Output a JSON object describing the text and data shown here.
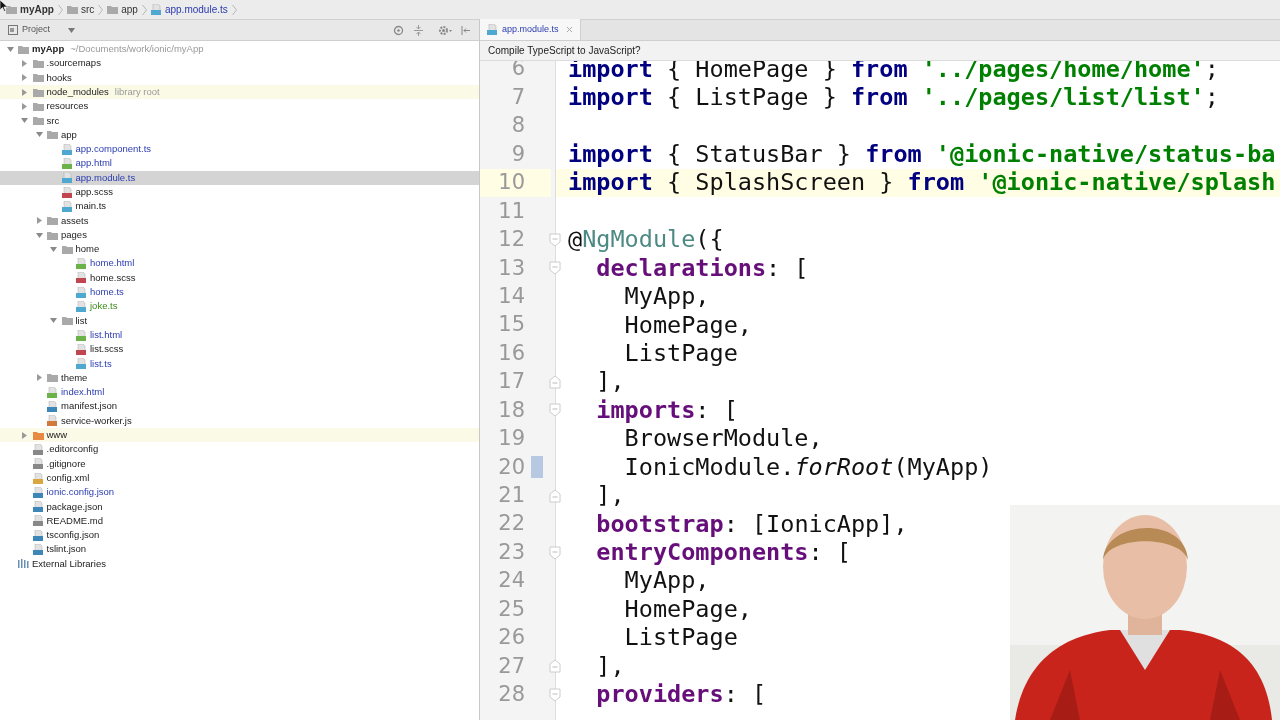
{
  "breadcrumbs": [
    {
      "label": "myApp",
      "kind": "folder"
    },
    {
      "label": "src",
      "kind": "folder"
    },
    {
      "label": "app",
      "kind": "folder"
    },
    {
      "label": "app.module.ts",
      "kind": "ts"
    }
  ],
  "project_panel": {
    "title": "Project",
    "tree": [
      {
        "name": "myApp",
        "note": "~/Documents/work/ionic/myApp",
        "kind": "folder",
        "expanded": true,
        "selected": false,
        "highlighted": false,
        "modified": false,
        "added": false,
        "children": [
          {
            "name": ".sourcemaps",
            "kind": "folder",
            "expanded": false,
            "selected": false,
            "highlighted": false,
            "modified": false,
            "added": false
          },
          {
            "name": "hooks",
            "kind": "folder",
            "expanded": false,
            "selected": false,
            "highlighted": false,
            "modified": false,
            "added": false
          },
          {
            "name": "node_modules",
            "note": "library root",
            "kind": "folder",
            "expanded": false,
            "selected": false,
            "highlighted": true,
            "modified": false,
            "added": false
          },
          {
            "name": "resources",
            "kind": "folder",
            "expanded": false,
            "selected": false,
            "highlighted": false,
            "modified": false,
            "added": false
          },
          {
            "name": "src",
            "kind": "folder",
            "expanded": true,
            "selected": false,
            "highlighted": false,
            "modified": false,
            "added": false,
            "children": [
              {
                "name": "app",
                "kind": "folder",
                "expanded": true,
                "selected": false,
                "highlighted": false,
                "modified": false,
                "added": false,
                "children": [
                  {
                    "name": "app.component.ts",
                    "kind": "ts",
                    "selected": false,
                    "highlighted": false,
                    "modified": true,
                    "added": false
                  },
                  {
                    "name": "app.html",
                    "kind": "html",
                    "selected": false,
                    "highlighted": false,
                    "modified": true,
                    "added": false
                  },
                  {
                    "name": "app.module.ts",
                    "kind": "ts",
                    "selected": true,
                    "highlighted": false,
                    "modified": true,
                    "added": false
                  },
                  {
                    "name": "app.scss",
                    "kind": "scss",
                    "selected": false,
                    "highlighted": false,
                    "modified": false,
                    "added": false
                  },
                  {
                    "name": "main.ts",
                    "kind": "ts",
                    "selected": false,
                    "highlighted": false,
                    "modified": false,
                    "added": false
                  }
                ]
              },
              {
                "name": "assets",
                "kind": "folder",
                "expanded": false,
                "selected": false,
                "highlighted": false,
                "modified": false,
                "added": false
              },
              {
                "name": "pages",
                "kind": "folder",
                "expanded": true,
                "selected": false,
                "highlighted": false,
                "modified": false,
                "added": false,
                "children": [
                  {
                    "name": "home",
                    "kind": "folder",
                    "expanded": true,
                    "selected": false,
                    "highlighted": false,
                    "modified": false,
                    "added": false,
                    "children": [
                      {
                        "name": "home.html",
                        "kind": "html",
                        "selected": false,
                        "highlighted": false,
                        "modified": true,
                        "added": false
                      },
                      {
                        "name": "home.scss",
                        "kind": "scss",
                        "selected": false,
                        "highlighted": false,
                        "modified": false,
                        "added": false
                      },
                      {
                        "name": "home.ts",
                        "kind": "ts",
                        "selected": false,
                        "highlighted": false,
                        "modified": true,
                        "added": false
                      },
                      {
                        "name": "joke.ts",
                        "kind": "ts",
                        "selected": false,
                        "highlighted": false,
                        "modified": false,
                        "added": true
                      }
                    ]
                  },
                  {
                    "name": "list",
                    "kind": "folder",
                    "expanded": true,
                    "selected": false,
                    "highlighted": false,
                    "modified": false,
                    "added": false,
                    "children": [
                      {
                        "name": "list.html",
                        "kind": "html",
                        "selected": false,
                        "highlighted": false,
                        "modified": true,
                        "added": false
                      },
                      {
                        "name": "list.scss",
                        "kind": "scss",
                        "selected": false,
                        "highlighted": false,
                        "modified": false,
                        "added": false
                      },
                      {
                        "name": "list.ts",
                        "kind": "ts",
                        "selected": false,
                        "highlighted": false,
                        "modified": true,
                        "added": false
                      }
                    ]
                  }
                ]
              },
              {
                "name": "theme",
                "kind": "folder",
                "expanded": false,
                "selected": false,
                "highlighted": false,
                "modified": false,
                "added": false
              },
              {
                "name": "index.html",
                "kind": "html",
                "selected": false,
                "highlighted": false,
                "modified": true,
                "added": false
              },
              {
                "name": "manifest.json",
                "kind": "json",
                "selected": false,
                "highlighted": false,
                "modified": false,
                "added": false
              },
              {
                "name": "service-worker.js",
                "kind": "js",
                "selected": false,
                "highlighted": false,
                "modified": false,
                "added": false
              }
            ]
          },
          {
            "name": "www",
            "kind": "excluded",
            "expanded": false,
            "selected": false,
            "highlighted": true,
            "modified": false,
            "added": false
          },
          {
            "name": ".editorconfig",
            "kind": "text",
            "selected": false,
            "highlighted": false,
            "modified": false,
            "added": false
          },
          {
            "name": ".gitignore",
            "kind": "text",
            "selected": false,
            "highlighted": false,
            "modified": false,
            "added": false
          },
          {
            "name": "config.xml",
            "kind": "xml",
            "selected": false,
            "highlighted": false,
            "modified": false,
            "added": false
          },
          {
            "name": "ionic.config.json",
            "kind": "json",
            "selected": false,
            "highlighted": false,
            "modified": true,
            "added": false
          },
          {
            "name": "package.json",
            "kind": "json",
            "selected": false,
            "highlighted": false,
            "modified": false,
            "added": false
          },
          {
            "name": "README.md",
            "kind": "text",
            "selected": false,
            "highlighted": false,
            "modified": false,
            "added": false
          },
          {
            "name": "tsconfig.json",
            "kind": "json",
            "selected": false,
            "highlighted": false,
            "modified": false,
            "added": false
          },
          {
            "name": "tslint.json",
            "kind": "json",
            "selected": false,
            "highlighted": false,
            "modified": false,
            "added": false
          }
        ]
      },
      {
        "name": "External Libraries",
        "kind": "libraries",
        "selected": false,
        "highlighted": false,
        "modified": false,
        "added": false
      }
    ]
  },
  "editor": {
    "tabs": [
      {
        "label": "app.module.ts",
        "kind": "ts",
        "selected": true
      }
    ],
    "notification": "Compile TypeScript to JavaScript?",
    "lines": [
      {
        "number": "6",
        "kind": "plain",
        "current": false,
        "changed": false,
        "tokens": [
          {
            "kind": "keyword",
            "text": "import"
          },
          {
            "kind": "plain",
            "text": " { HomePage } "
          },
          {
            "kind": "keyword",
            "text": "from"
          },
          {
            "kind": "string",
            "text": " '../pages/home/home'"
          },
          {
            "kind": "plain",
            "text": ";"
          }
        ]
      },
      {
        "number": "7",
        "kind": "plain",
        "current": false,
        "changed": false,
        "tokens": [
          {
            "kind": "keyword",
            "text": "import"
          },
          {
            "kind": "plain",
            "text": " { ListPage } "
          },
          {
            "kind": "keyword",
            "text": "from"
          },
          {
            "kind": "string",
            "text": " '../pages/list/list'"
          },
          {
            "kind": "plain",
            "text": ";"
          }
        ]
      },
      {
        "number": "8",
        "kind": "plain",
        "current": false,
        "changed": false
      },
      {
        "number": "9",
        "kind": "plain",
        "current": false,
        "changed": false,
        "tokens": [
          {
            "kind": "keyword",
            "text": "import"
          },
          {
            "kind": "plain",
            "text": " { StatusBar } "
          },
          {
            "kind": "keyword",
            "text": "from"
          },
          {
            "kind": "string",
            "text": " '@ionic-native/status-ba"
          }
        ]
      },
      {
        "number": "10",
        "kind": "plain",
        "current": true,
        "changed": false,
        "tokens": [
          {
            "kind": "keyword",
            "text": "import"
          },
          {
            "kind": "plain",
            "text": " { SplashScreen } "
          },
          {
            "kind": "keyword",
            "text": "from"
          },
          {
            "kind": "string",
            "text": " '@ionic-native/splash"
          }
        ]
      },
      {
        "number": "11",
        "kind": "plain",
        "current": false,
        "changed": false
      },
      {
        "number": "12",
        "kind": "fold-start",
        "current": false,
        "changed": false,
        "tokens": [
          {
            "kind": "plain",
            "text": "@"
          },
          {
            "kind": "decorator",
            "text": "NgModule"
          },
          {
            "kind": "plain",
            "text": "({"
          }
        ]
      },
      {
        "number": "13",
        "kind": "fold-start",
        "current": false,
        "changed": false,
        "tokens": [
          {
            "kind": "key",
            "text": "  declarations"
          },
          {
            "kind": "plain",
            "text": ": ["
          }
        ]
      },
      {
        "number": "14",
        "kind": "plain",
        "current": false,
        "changed": false,
        "tokens": [
          {
            "kind": "plain",
            "text": "    MyApp,"
          }
        ]
      },
      {
        "number": "15",
        "kind": "plain",
        "current": false,
        "changed": false,
        "tokens": [
          {
            "kind": "plain",
            "text": "    HomePage,"
          }
        ]
      },
      {
        "number": "16",
        "kind": "plain",
        "current": false,
        "changed": false,
        "tokens": [
          {
            "kind": "plain",
            "text": "    ListPage"
          }
        ]
      },
      {
        "number": "17",
        "kind": "fold-end",
        "current": false,
        "changed": false,
        "tokens": [
          {
            "kind": "plain",
            "text": "  ],"
          }
        ]
      },
      {
        "number": "18",
        "kind": "fold-start",
        "current": false,
        "changed": false,
        "tokens": [
          {
            "kind": "key",
            "text": "  imports"
          },
          {
            "kind": "plain",
            "text": ": ["
          }
        ]
      },
      {
        "number": "19",
        "kind": "plain",
        "current": false,
        "changed": false,
        "tokens": [
          {
            "kind": "plain",
            "text": "    BrowserModule,"
          }
        ]
      },
      {
        "number": "20",
        "kind": "plain",
        "current": false,
        "changed": true,
        "tokens": [
          {
            "kind": "plain",
            "text": "    IonicModule."
          },
          {
            "kind": "call",
            "text": "forRoot"
          },
          {
            "kind": "plain",
            "text": "(MyApp)"
          }
        ]
      },
      {
        "number": "21",
        "kind": "fold-end",
        "current": false,
        "changed": false,
        "tokens": [
          {
            "kind": "plain",
            "text": "  ],"
          }
        ]
      },
      {
        "number": "22",
        "kind": "plain",
        "current": false,
        "changed": false,
        "tokens": [
          {
            "kind": "key",
            "text": "  bootstrap"
          },
          {
            "kind": "plain",
            "text": ": [IonicApp],"
          }
        ]
      },
      {
        "number": "23",
        "kind": "fold-start",
        "current": false,
        "changed": false,
        "tokens": [
          {
            "kind": "key",
            "text": "  entryComponents"
          },
          {
            "kind": "plain",
            "text": ": ["
          }
        ]
      },
      {
        "number": "24",
        "kind": "plain",
        "current": false,
        "changed": false,
        "tokens": [
          {
            "kind": "plain",
            "text": "    MyApp,"
          }
        ]
      },
      {
        "number": "25",
        "kind": "plain",
        "current": false,
        "changed": false,
        "tokens": [
          {
            "kind": "plain",
            "text": "    HomePage,"
          }
        ]
      },
      {
        "number": "26",
        "kind": "plain",
        "current": false,
        "changed": false,
        "tokens": [
          {
            "kind": "plain",
            "text": "    ListPage"
          }
        ]
      },
      {
        "number": "27",
        "kind": "fold-end",
        "current": false,
        "changed": false,
        "tokens": [
          {
            "kind": "plain",
            "text": "  ],"
          }
        ]
      },
      {
        "number": "28",
        "kind": "fold-start",
        "current": false,
        "changed": false,
        "tokens": [
          {
            "kind": "key",
            "text": "  providers"
          },
          {
            "kind": "plain",
            "text": ": ["
          }
        ]
      }
    ]
  }
}
